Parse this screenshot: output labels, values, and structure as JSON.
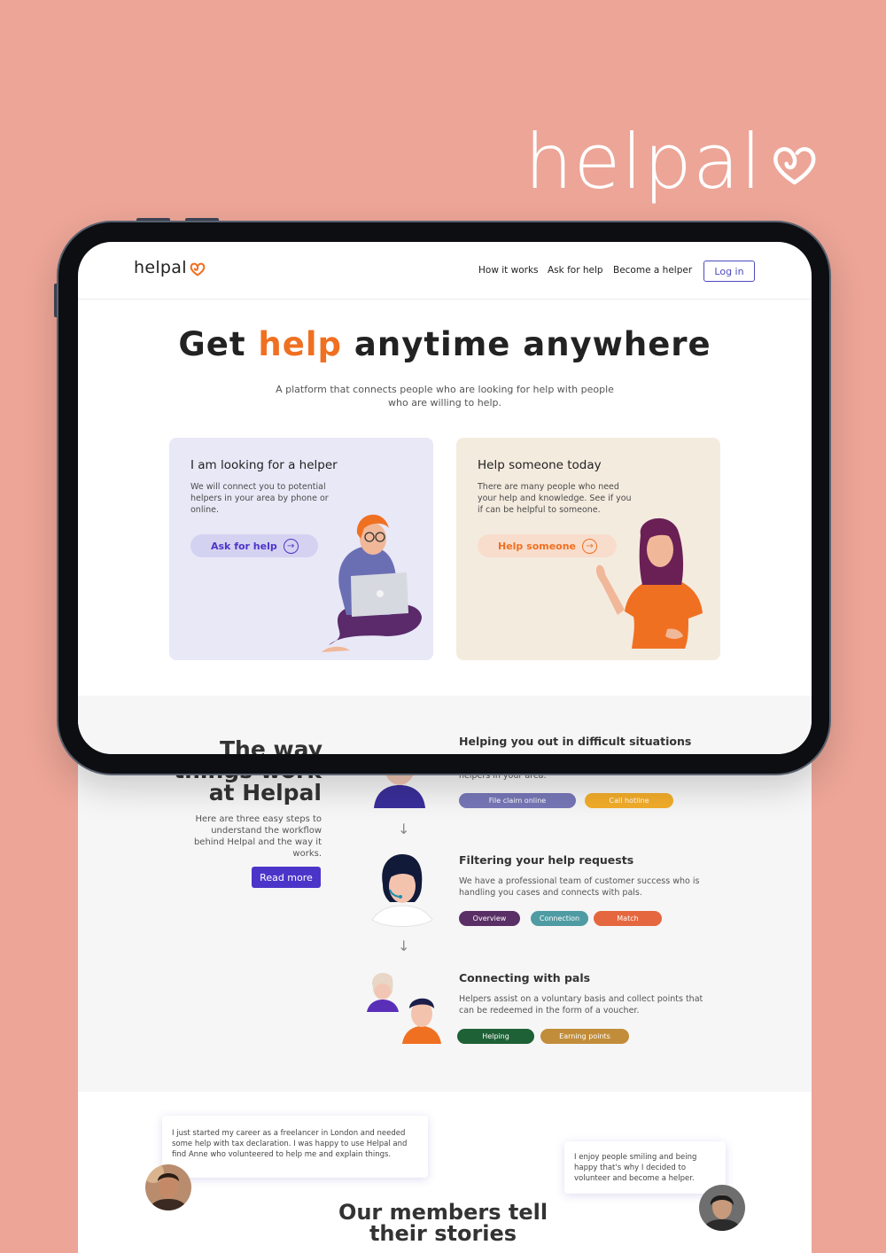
{
  "brand": {
    "name": "helpal"
  },
  "nav": {
    "logo": "helpal",
    "links": [
      "How it works",
      "Ask for help",
      "Become a helper"
    ],
    "login": "Log in"
  },
  "hero": {
    "title_before": "Get ",
    "title_accent": "help",
    "title_after": " anytime anywhere",
    "subtitle": "A platform that connects people who are looking for help with people who are willing to help."
  },
  "cards": [
    {
      "title": "I am looking for a helper",
      "text": "We will connect you to potential helpers in your area by phone or online.",
      "button": "Ask for help"
    },
    {
      "title": "Help someone today",
      "text": "There are many people who need your help and knowledge. See if you if can be helpful to someone.",
      "button": "Help someone"
    }
  ],
  "how": {
    "title_lines": [
      "The way",
      "things work",
      "at Helpal"
    ],
    "description": "Here are three easy steps to understand the workflow behind Helpal and the way it works.",
    "button": "Read more"
  },
  "steps": [
    {
      "title": "Helping you out in difficult situations",
      "text": "helpers in your area.",
      "tags": [
        "File claim online",
        "Call hotline"
      ]
    },
    {
      "title": "Filtering your help requests",
      "text": "We have a professional team of customer success who is handling you cases and connects with pals.",
      "tags": [
        "Overview",
        "Connection",
        "Match"
      ]
    },
    {
      "title": "Connecting with pals",
      "text": "Helpers assist on a voluntary basis and collect points that can be redeemed in the form of a voucher.",
      "tags": [
        "Helping",
        "Earning points"
      ]
    }
  ],
  "testimonials": [
    "I just started my career as a freelancer in London and needed some help with tax declaration. I was happy to use Helpal and find Anne who volunteered to help me and explain things.",
    "I enjoy people smiling and being happy that's why I decided to volunteer and become a helper."
  ],
  "stories": {
    "title_lines": [
      "Our members tell",
      "their stories"
    ]
  },
  "colors": {
    "background": "#eca597",
    "accent_orange": "#f07022",
    "primary_purple": "#4b35c9",
    "card_blue": "#e8e8f7",
    "card_beige": "#f4ebdf"
  },
  "icons": [
    "heart-logo-icon",
    "arrow-right-circle-icon",
    "arrow-down-icon",
    "question-mark-icon"
  ]
}
